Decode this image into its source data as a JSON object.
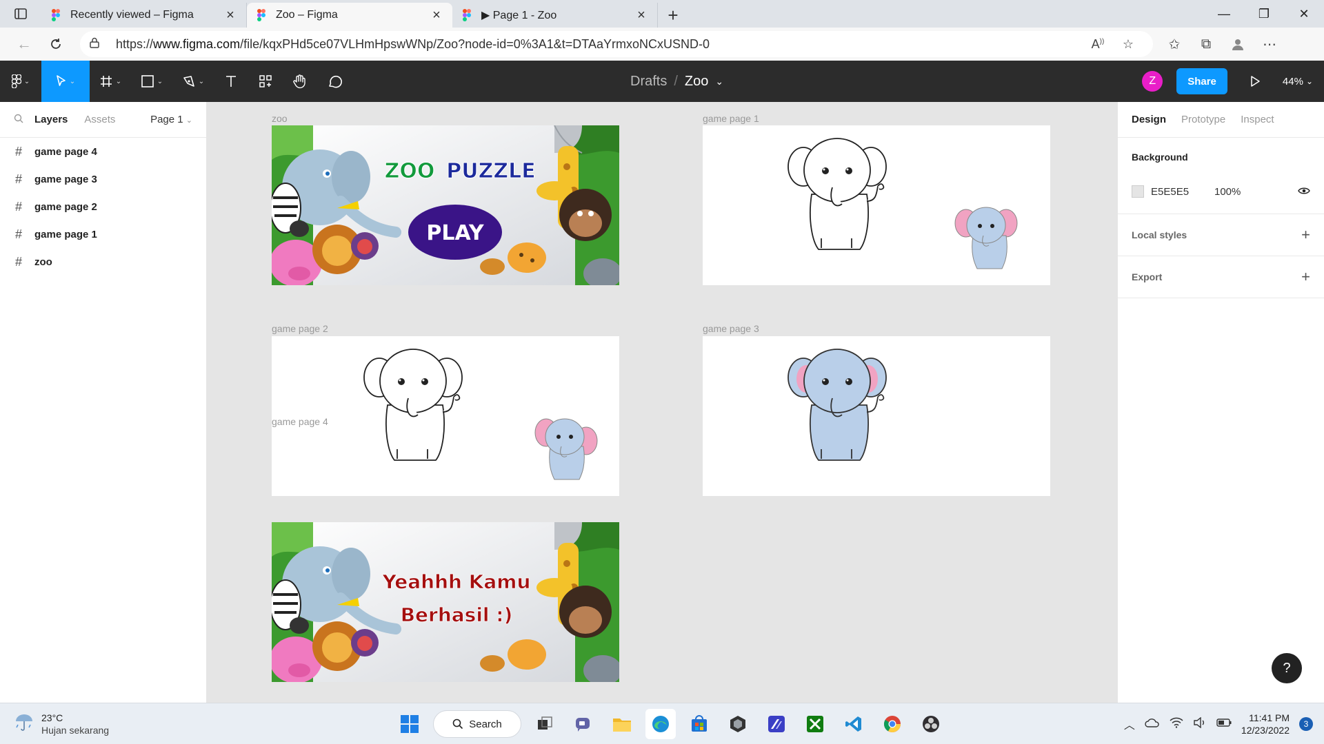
{
  "browser": {
    "tabs": [
      {
        "title": "Recently viewed – Figma",
        "active": false
      },
      {
        "title": "Zoo – Figma",
        "active": true
      },
      {
        "title": "▶ Page 1 - Zoo",
        "active": false
      }
    ],
    "url_prefix": "https://",
    "url_domain": "www.figma.com",
    "url_rest": "/file/kqxPHd5ce07VLHmHpswWNp/Zoo?node-id=0%3A1&t=DTAaYrmxoNCxUSND-0"
  },
  "figma": {
    "breadcrumb_parent": "Drafts",
    "breadcrumb_separator": "/",
    "file_name": "Zoo",
    "avatar_letter": "Z",
    "share_label": "Share",
    "zoom": "44%",
    "accent": "#0d99ff"
  },
  "left_panel": {
    "tab_layers": "Layers",
    "tab_assets": "Assets",
    "page_selector": "Page 1",
    "layers": [
      "game page 4",
      "game page 3",
      "game page 2",
      "game page 1",
      "zoo"
    ]
  },
  "canvas": {
    "frames": [
      {
        "label": "zoo",
        "kind": "title",
        "title_left": "ZOO",
        "title_right": "PUZZLE",
        "button": "PLAY"
      },
      {
        "label": "game page 1",
        "kind": "outline-plus-small"
      },
      {
        "label": "game page 2",
        "kind": "outline-plus-small"
      },
      {
        "label": "game page 3",
        "kind": "colored"
      },
      {
        "label": "game page 4",
        "kind": "win",
        "line1": "Yeahhh Kamu",
        "line2": "Berhasil :)"
      }
    ]
  },
  "right_panel": {
    "tabs": [
      "Design",
      "Prototype",
      "Inspect"
    ],
    "background_title": "Background",
    "background_hex": "E5E5E5",
    "background_opacity": "100%",
    "local_styles": "Local styles",
    "export": "Export",
    "help": "?"
  },
  "taskbar": {
    "temperature": "23°C",
    "weather": "Hujan sekarang",
    "search_label": "Search",
    "time": "11:41 PM",
    "date": "12/23/2022",
    "notification_count": "3"
  }
}
